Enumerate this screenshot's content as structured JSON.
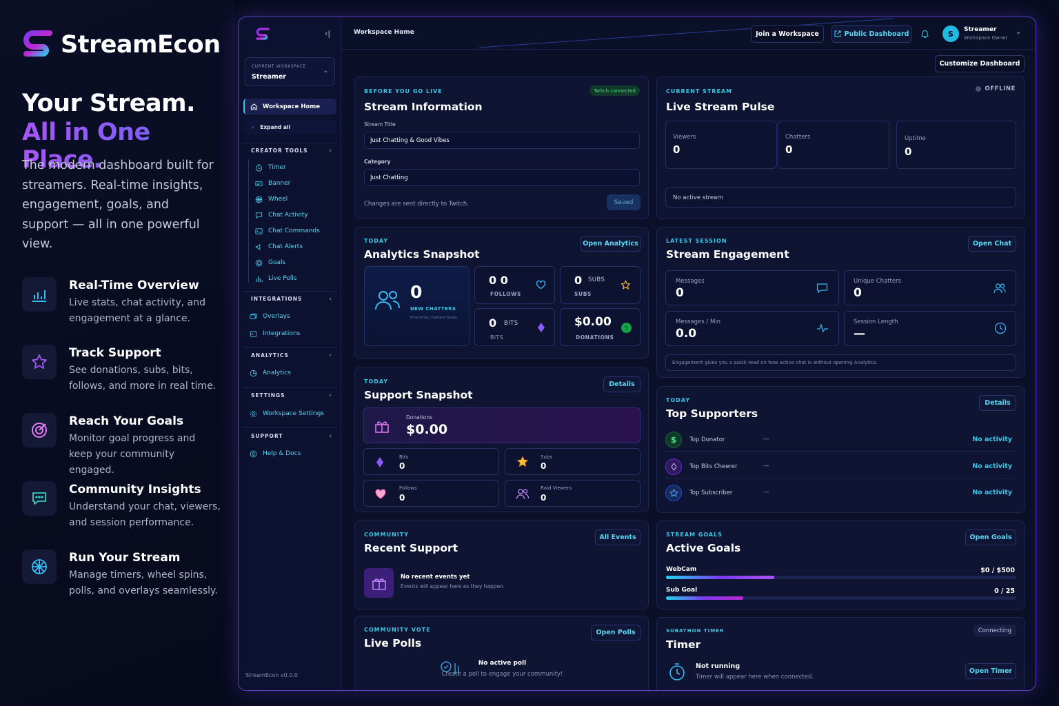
{
  "promo": {
    "brand": "StreamEcon",
    "hero_line1": "Your Stream.",
    "hero_line2": "All in One Place.",
    "description": "The modern dashboard built for streamers. Real-time insights, engagement, goals, and support — all in one powerful view.",
    "features": [
      {
        "title": "Real-Time Overview",
        "desc": "Live stats, chat activity, and engagement at a glance.",
        "icon": "bar-chart-icon"
      },
      {
        "title": "Track Support",
        "desc": "See donations, subs, bits, follows, and more in real time.",
        "icon": "star-icon"
      },
      {
        "title": "Reach Your Goals",
        "desc": "Monitor goal progress and keep your community engaged.",
        "icon": "target-icon"
      },
      {
        "title": "Community Insights",
        "desc": "Understand your chat, viewers, and session performance.",
        "icon": "chat-icon"
      },
      {
        "title": "Run Your Stream",
        "desc": "Manage timers, wheel spins, polls, and overlays seamlessly.",
        "icon": "wheel-icon"
      }
    ]
  },
  "sidebar": {
    "workspace_label": "CURRENT WORKSPACE",
    "workspace_name": "Streamer",
    "home": "Workspace Home",
    "expand": "Expand all",
    "sections": {
      "creator": "CREATOR TOOLS",
      "integrations": "INTEGRATIONS",
      "analytics": "ANALYTICS",
      "settings": "SETTINGS",
      "support": "SUPPORT"
    },
    "creator_items": [
      "Timer",
      "Banner",
      "Wheel",
      "Chat Activity",
      "Chat Commands",
      "Chat Alerts",
      "Goals",
      "Live Polls"
    ],
    "integration_items": [
      "Overlays",
      "Integrations"
    ],
    "analytics_items": [
      "Analytics"
    ],
    "settings_items": [
      "Workspace Settings"
    ],
    "support_items": [
      "Help & Docs"
    ],
    "version": "StreamEcon v0.0.0"
  },
  "topbar": {
    "breadcrumb": "Workspace Home",
    "join_label": "Join a Workspace",
    "public_label": "Public Dashboard",
    "user_initial": "S",
    "user_name": "Streamer",
    "user_role": "Workspace Owner",
    "customize_label": "Customize Dashboard"
  },
  "stream_info": {
    "eyebrow": "BEFORE YOU GO LIVE",
    "title": "Stream Information",
    "badge": "Twitch connected",
    "title_label": "Stream Title",
    "title_value": "Just Chatting & Good Vibes",
    "category_label": "Category",
    "category_value": "Just Chatting",
    "note": "Changes are sent directly to Twitch.",
    "save_label": "Saved"
  },
  "pulse": {
    "eyebrow": "CURRENT STREAM",
    "title": "Live Stream Pulse",
    "status": "OFFLINE",
    "viewers_label": "Viewers",
    "viewers": "0",
    "chatters_label": "Chatters",
    "chatters": "0",
    "uptime_label": "Uptime",
    "uptime": "0",
    "message": "No active stream"
  },
  "analytics": {
    "eyebrow": "TODAY",
    "title": "Analytics Snapshot",
    "button": "Open Analytics",
    "new_chatters": "0",
    "new_chatters_label": "NEW CHATTERS",
    "new_chatters_sub": "First-time chatters today",
    "follows_val": "0 0",
    "follows_label": "FOLLOWS",
    "subs_val": "0",
    "subs_inline": "SUBS",
    "subs_label": "SUBS",
    "bits_val": "0",
    "bits_inline": "BITS",
    "bits_label": "BITS",
    "donations_val": "$0.00",
    "donations_label": "DONATIONS"
  },
  "engagement": {
    "eyebrow": "LATEST SESSION",
    "title": "Stream Engagement",
    "button": "Open Chat",
    "messages_label": "Messages",
    "messages": "0",
    "unique_label": "Unique Chatters",
    "unique": "0",
    "mpm_label": "Messages / Min",
    "mpm": "0.0",
    "length_label": "Session Length",
    "length": "—",
    "note": "Engagement gives you a quick read on how active chat is without opening Analytics."
  },
  "support": {
    "eyebrow": "TODAY",
    "title": "Support Snapshot",
    "button": "Details",
    "donations_label": "Donations",
    "donations": "$0.00",
    "bits_label": "Bits",
    "bits": "0",
    "subs_label": "Subs",
    "subs": "0",
    "follows_label": "Follows",
    "follows": "0",
    "raid_label": "Raid Viewers",
    "raid": "0"
  },
  "supporters": {
    "eyebrow": "TODAY",
    "title": "Top Supporters",
    "button": "Details",
    "rows": [
      {
        "label": "Top Donator",
        "value": "—",
        "status": "No activity"
      },
      {
        "label": "Top Bits Cheerer",
        "value": "—",
        "status": "No activity"
      },
      {
        "label": "Top Subscriber",
        "value": "—",
        "status": "No activity"
      }
    ]
  },
  "recent": {
    "eyebrow": "COMMUNITY",
    "title": "Recent Support",
    "button": "All Events",
    "empty_title": "No recent events yet",
    "empty_desc": "Events will appear here as they happen."
  },
  "goals": {
    "eyebrow": "STREAM GOALS",
    "title": "Active Goals",
    "button": "Open Goals",
    "items": [
      {
        "name": "WebCam",
        "progress": "$0 / $500",
        "fraction": 0.31
      },
      {
        "name": "Sub Goal",
        "progress": "0 / 25",
        "fraction": 0.22
      }
    ]
  },
  "polls": {
    "eyebrow": "COMMUNITY VOTE",
    "title": "Live Polls",
    "button": "Open Polls",
    "empty_title": "No active poll",
    "empty_desc": "Create a poll to engage your community!"
  },
  "timer": {
    "eyebrow": "SUBATHON TIMER",
    "title": "Timer",
    "status": "Connecting",
    "state": "Not running",
    "desc": "Timer will appear here when connected.",
    "button": "Open Timer"
  },
  "colors": {
    "accent": "#38c8e8",
    "purple": "#8b5cf6",
    "green": "#22c55e"
  }
}
